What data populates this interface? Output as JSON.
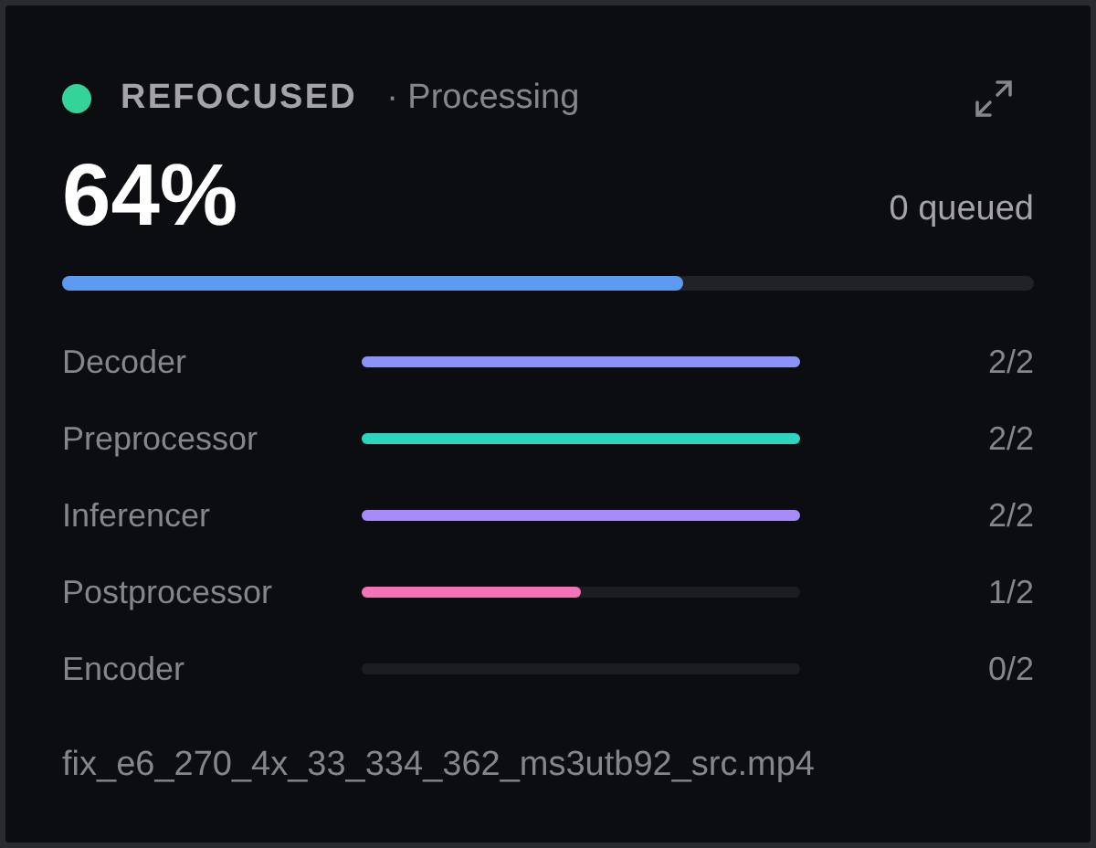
{
  "header": {
    "color": "#34d399",
    "title": "REFOCUSED",
    "status": "· Processing"
  },
  "progress": {
    "percent": "64%",
    "queued": "0 queued",
    "level": 0.64
  },
  "stages": [
    {
      "name": "Decoder",
      "color": "#8b93f8",
      "level": 1,
      "count": "2/2"
    },
    {
      "name": "Preprocessor",
      "color": "#2dd4bf",
      "level": 1,
      "count": "2/2"
    },
    {
      "name": "Inferencer",
      "color": "#a78bfa",
      "level": 1,
      "count": "2/2"
    },
    {
      "name": "Postprocessor",
      "color": "#f472b6",
      "level": 0.5,
      "count": "1/2"
    },
    {
      "name": "Encoder",
      "count": "0/2"
    }
  ],
  "file": "fix_e6_270_4x_33_334_362_ms3utb92_src.mp4"
}
